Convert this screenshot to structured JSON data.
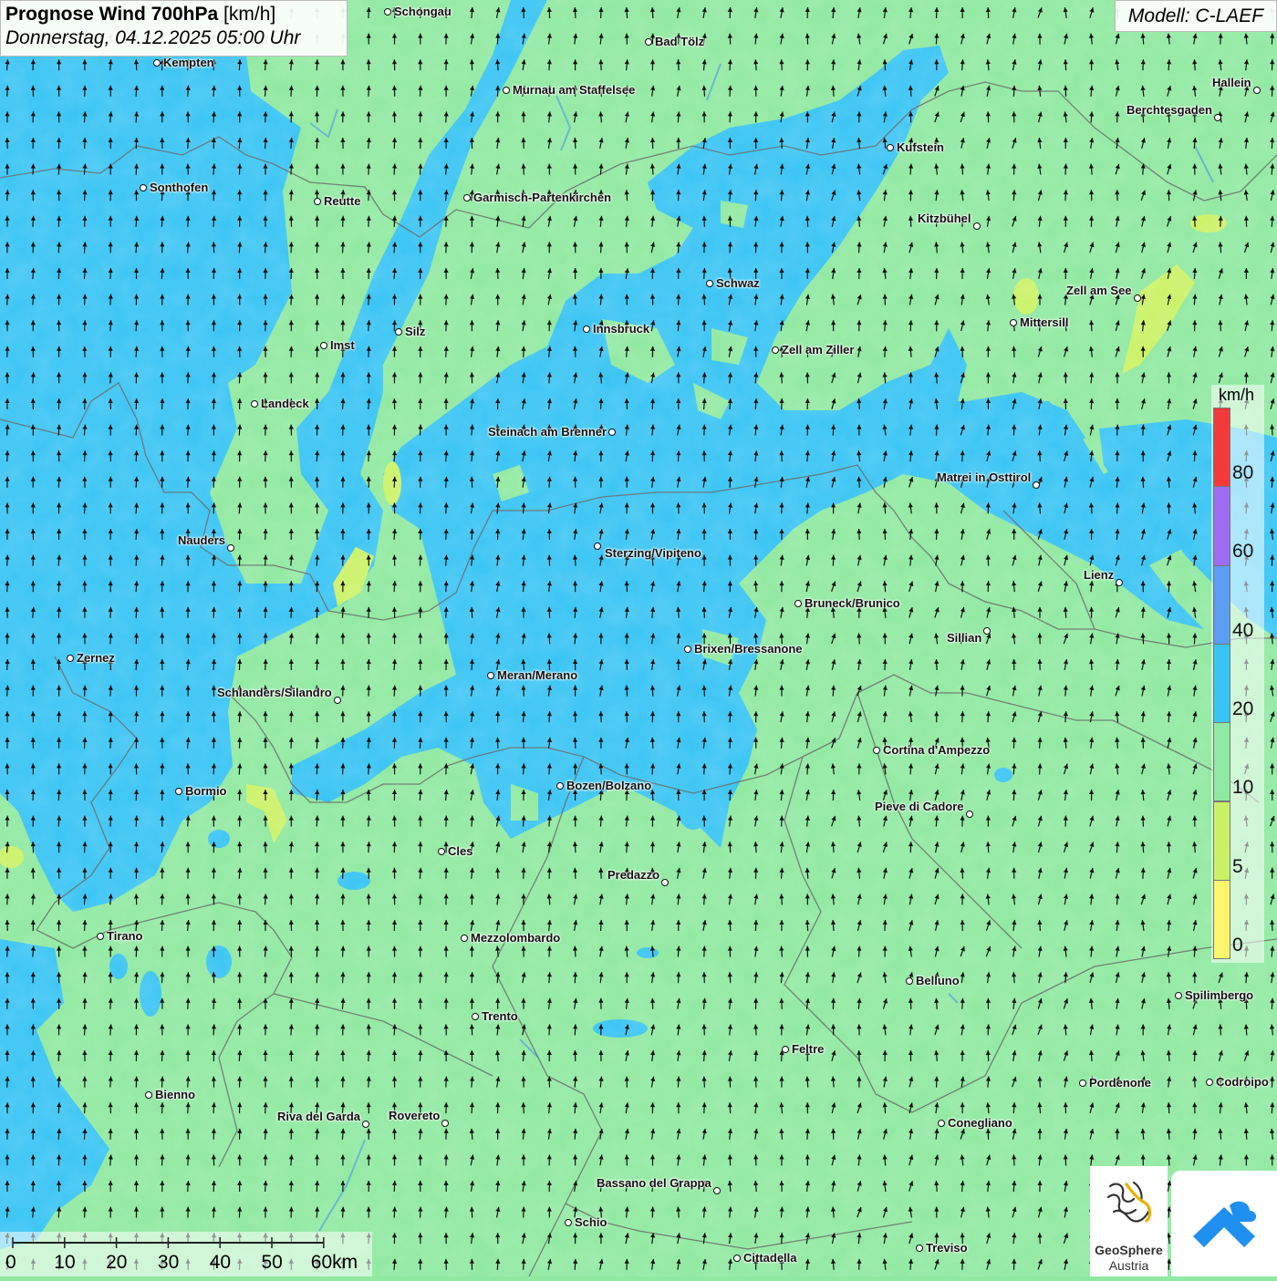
{
  "header": {
    "title_bold": "Prognose Wind 700hPa",
    "title_unit": "[km/h]",
    "datetime": "Donnerstag, 04.12.2025 05:00 Uhr",
    "model": "Modell: C-LAEF"
  },
  "legend": {
    "unit": "km/h",
    "bins": [
      {
        "label": "80",
        "color": "#f23a3a"
      },
      {
        "label": "60",
        "color": "#9d6cf0"
      },
      {
        "label": "40",
        "color": "#5b9df0"
      },
      {
        "label": "20",
        "color": "#38c4f4"
      },
      {
        "label": "10",
        "color": "#8fe9a0"
      },
      {
        "label": "5",
        "color": "#cbf266"
      },
      {
        "label": "0",
        "color": "#faf56b"
      }
    ]
  },
  "scale": {
    "labels": [
      "0",
      "10",
      "20",
      "30",
      "40",
      "50",
      "60km"
    ]
  },
  "logos": {
    "geosphere_line1": "GeoSphere",
    "geosphere_line2": "Austria"
  },
  "cities": [
    {
      "name": "Schongau"
    },
    {
      "name": "Bad Tölz"
    },
    {
      "name": "Kempten"
    },
    {
      "name": "Murnau am Staffelsee"
    },
    {
      "name": "Hallein"
    },
    {
      "name": "Berchtesgaden"
    },
    {
      "name": "Kufstein"
    },
    {
      "name": "Sonthofen"
    },
    {
      "name": "Reutte"
    },
    {
      "name": "Garmisch-Partenkirchen"
    },
    {
      "name": "Kitzbühel"
    },
    {
      "name": "Schwaz"
    },
    {
      "name": "Zell am See"
    },
    {
      "name": "Mittersill"
    },
    {
      "name": "Innsbruck"
    },
    {
      "name": "Silz"
    },
    {
      "name": "Imst"
    },
    {
      "name": "Zell am Ziller"
    },
    {
      "name": "Landeck"
    },
    {
      "name": "Steinach am Brenner"
    },
    {
      "name": "Matrei in Osttirol"
    },
    {
      "name": "Nauders"
    },
    {
      "name": "Sterzing/Vipiteno"
    },
    {
      "name": "Lienz"
    },
    {
      "name": "Bruneck/Brunico"
    },
    {
      "name": "Sillian"
    },
    {
      "name": "Zernez"
    },
    {
      "name": "Brixen/Bressanone"
    },
    {
      "name": "Meran/Merano"
    },
    {
      "name": "Schlanders/Silandro"
    },
    {
      "name": "Cortina d'Ampezzo"
    },
    {
      "name": "Bormio"
    },
    {
      "name": "Bozen/Bolzano"
    },
    {
      "name": "Pieve di Cadore"
    },
    {
      "name": "Cles"
    },
    {
      "name": "Predazzo"
    },
    {
      "name": "Tirano"
    },
    {
      "name": "Mezzolombardo"
    },
    {
      "name": "Belluno"
    },
    {
      "name": "Spilimbergo"
    },
    {
      "name": "Trento"
    },
    {
      "name": "Feltre"
    },
    {
      "name": "Pordenone"
    },
    {
      "name": "Codroipo"
    },
    {
      "name": "Bienno"
    },
    {
      "name": "Riva del Garda"
    },
    {
      "name": "Rovereto"
    },
    {
      "name": "Conegliano"
    },
    {
      "name": "Bassano del Grappa"
    },
    {
      "name": "Schio"
    },
    {
      "name": "Treviso"
    },
    {
      "name": "Cittadella"
    }
  ]
}
